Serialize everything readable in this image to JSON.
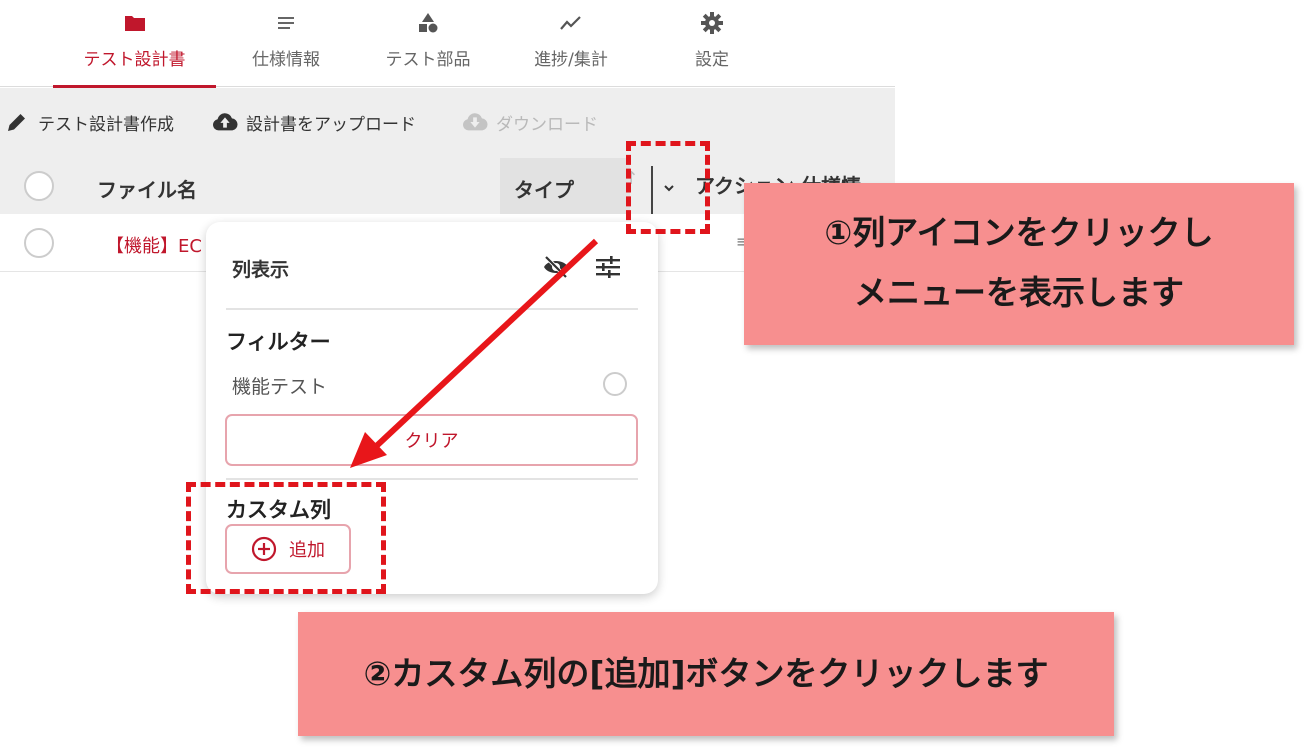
{
  "nav": {
    "tabs": [
      {
        "label": "テスト設計書",
        "icon": "folder-icon",
        "active": true
      },
      {
        "label": "仕様情報",
        "icon": "list-icon",
        "active": false
      },
      {
        "label": "テスト部品",
        "icon": "shapes-icon",
        "active": false
      },
      {
        "label": "進捗/集計",
        "icon": "trend-icon",
        "active": false
      },
      {
        "label": "設定",
        "icon": "gear-icon",
        "active": false
      }
    ]
  },
  "toolbar": {
    "create_label": "テスト設計書作成",
    "upload_label": "設計書をアップロード",
    "download_label": "ダウンロード"
  },
  "table": {
    "columns": {
      "file_name": "ファイル名",
      "type": "タイプ",
      "clipped_next": "アクション  仕様情"
    },
    "rows": [
      {
        "file_name": "【機能】EC"
      }
    ]
  },
  "column_menu": {
    "title": "列表示",
    "filter_heading": "フィルター",
    "filter_item": "機能テスト",
    "clear_label": "クリア",
    "custom_heading": "カスタム列",
    "add_label": "追加"
  },
  "annotations": {
    "callout1_line1": "①列アイコンをクリックし",
    "callout1_line2": "メニューを表示します",
    "callout2": "②カスタム列の[追加]ボタンをクリックします"
  },
  "colors": {
    "accent": "#c0172c",
    "annotation_red": "#e0151c",
    "callout_bg": "#f78f8f",
    "toolbar_bg": "#eeeeee"
  }
}
